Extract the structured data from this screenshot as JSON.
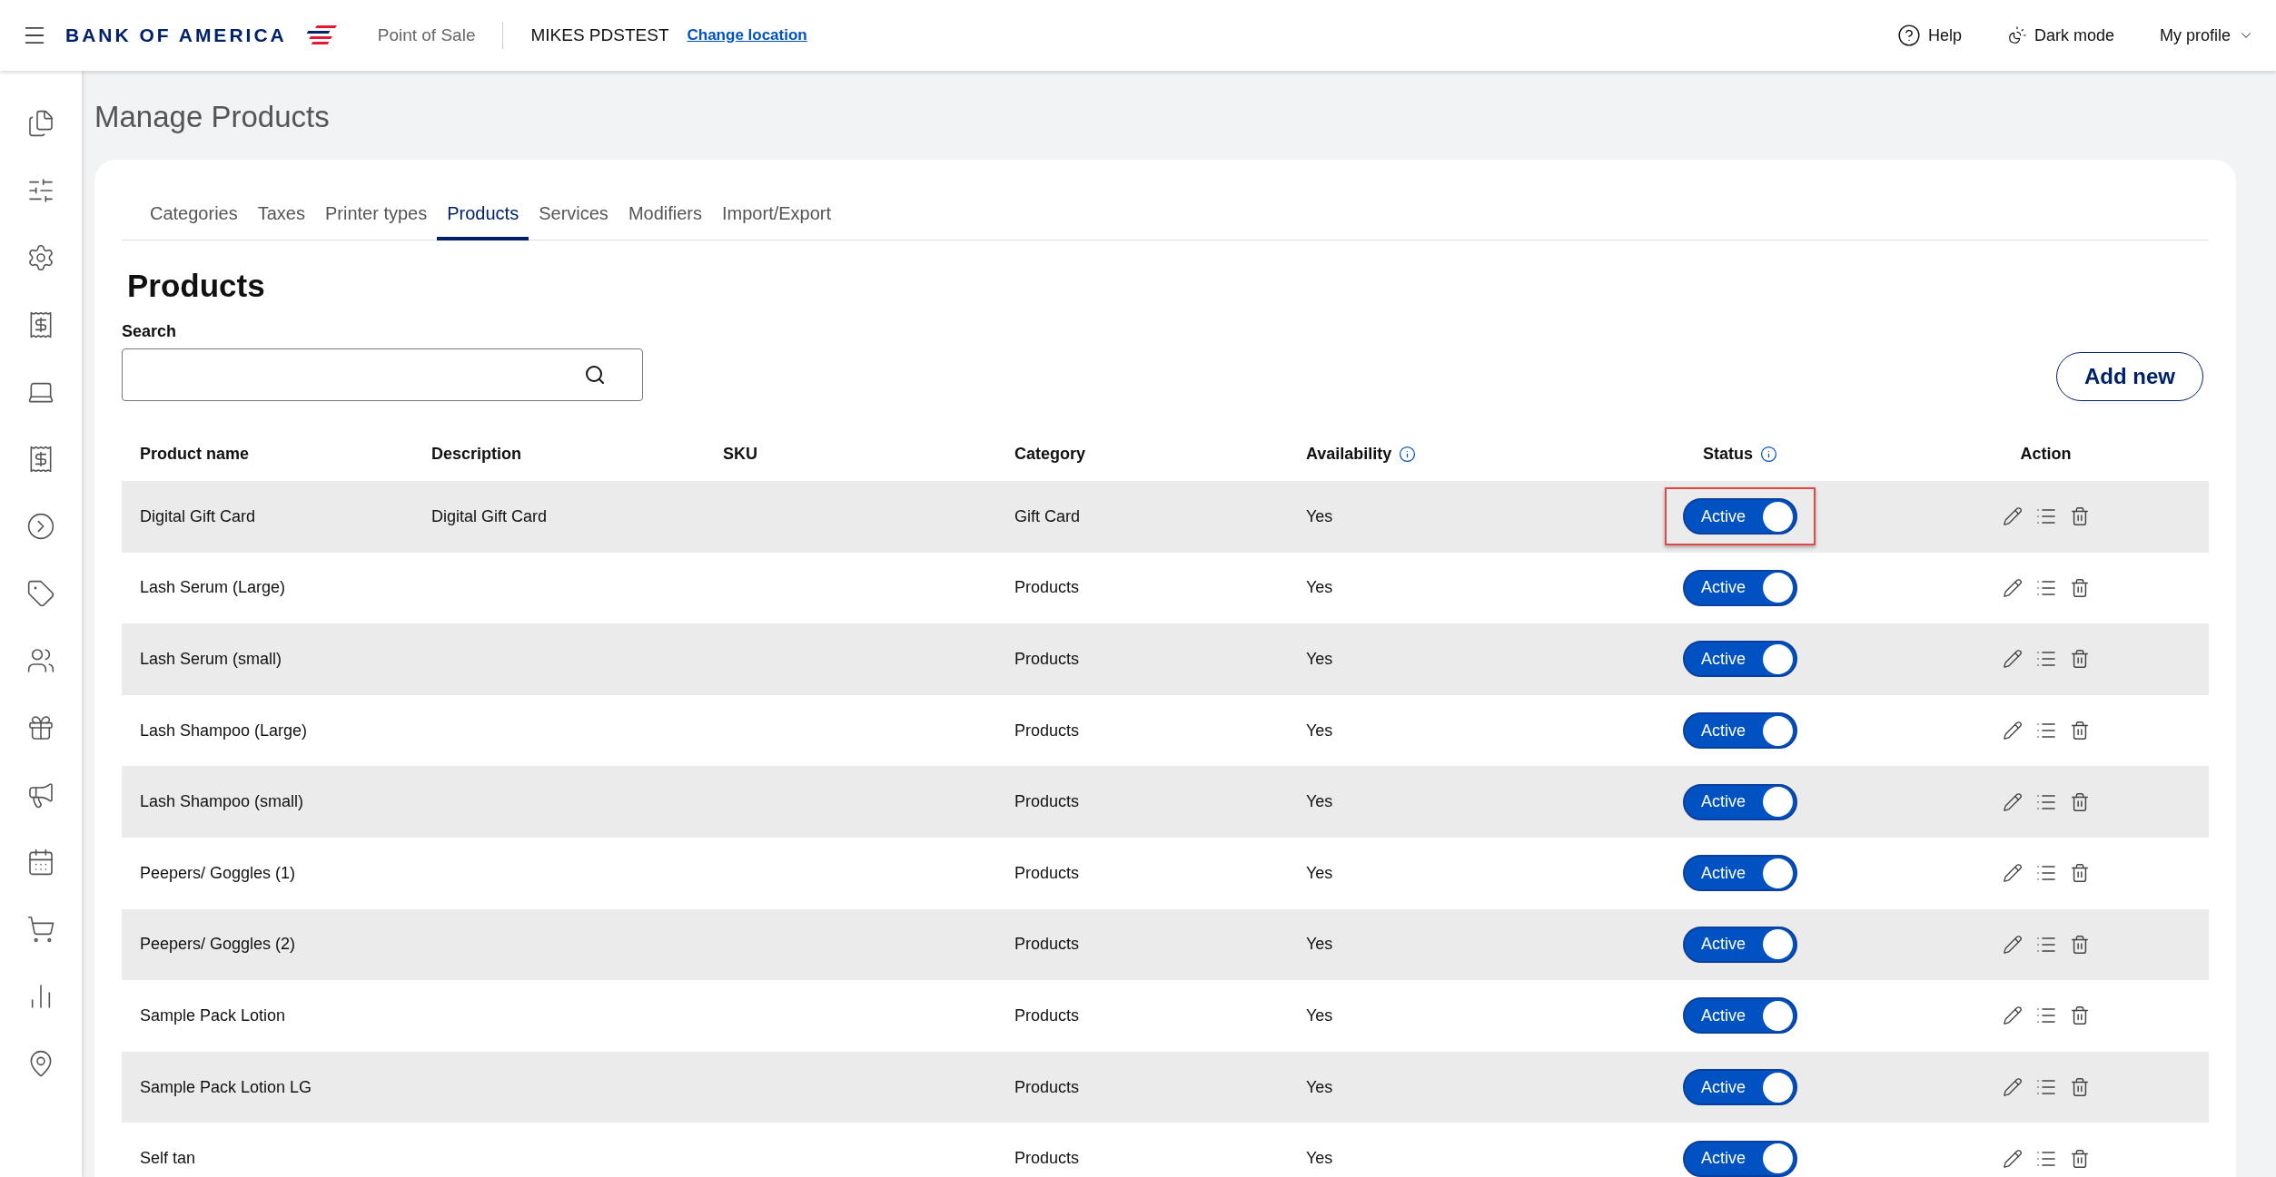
{
  "header": {
    "brand": "BANK OF AMERICA",
    "app_name": "Point of Sale",
    "location": "MIKES PDSTEST",
    "change_location": "Change location",
    "help": "Help",
    "dark_mode": "Dark mode",
    "profile": "My profile"
  },
  "page_title": "Manage Products",
  "tabs": [
    {
      "label": "Categories",
      "selected": false
    },
    {
      "label": "Taxes",
      "selected": false
    },
    {
      "label": "Printer types",
      "selected": false
    },
    {
      "label": "Products",
      "selected": true
    },
    {
      "label": "Services",
      "selected": false
    },
    {
      "label": "Modifiers",
      "selected": false
    },
    {
      "label": "Import/Export",
      "selected": false
    }
  ],
  "section_title": "Products",
  "search": {
    "label": "Search"
  },
  "add_button": "Add new",
  "table": {
    "columns": [
      {
        "label": "Product name",
        "info": false
      },
      {
        "label": "Description",
        "info": false
      },
      {
        "label": "SKU",
        "info": false
      },
      {
        "label": "Category",
        "info": false
      },
      {
        "label": "Availability",
        "info": true
      },
      {
        "label": "Status",
        "info": true
      },
      {
        "label": "Action",
        "info": false
      }
    ],
    "rows": [
      {
        "name": "Digital Gift Card",
        "description": "Digital Gift Card",
        "category": "Gift Card",
        "availability": "Yes",
        "status": "Active",
        "on": true,
        "highlighted": true
      },
      {
        "name": "Lash Serum (Large)",
        "category": "Products",
        "availability": "Yes",
        "status": "Active",
        "on": true,
        "highlighted": false
      },
      {
        "name": "Lash Serum (small)",
        "category": "Products",
        "availability": "Yes",
        "status": "Active",
        "on": true,
        "highlighted": false
      },
      {
        "name": "Lash Shampoo (Large)",
        "category": "Products",
        "availability": "Yes",
        "status": "Active",
        "on": true,
        "highlighted": false
      },
      {
        "name": "Lash Shampoo (small)",
        "category": "Products",
        "availability": "Yes",
        "status": "Active",
        "on": true,
        "highlighted": false
      },
      {
        "name": "Peepers/ Goggles (1)",
        "category": "Products",
        "availability": "Yes",
        "status": "Active",
        "on": true,
        "highlighted": false
      },
      {
        "name": "Peepers/ Goggles (2)",
        "category": "Products",
        "availability": "Yes",
        "status": "Active",
        "on": true,
        "highlighted": false
      },
      {
        "name": "Sample Pack Lotion",
        "category": "Products",
        "availability": "Yes",
        "status": "Active",
        "on": true,
        "highlighted": false
      },
      {
        "name": "Sample Pack Lotion LG",
        "category": "Products",
        "availability": "Yes",
        "status": "Active",
        "on": true,
        "highlighted": false
      },
      {
        "name": "Self tan",
        "category": "Products",
        "availability": "Yes",
        "status": "Active",
        "on": true,
        "highlighted": false
      }
    ]
  }
}
